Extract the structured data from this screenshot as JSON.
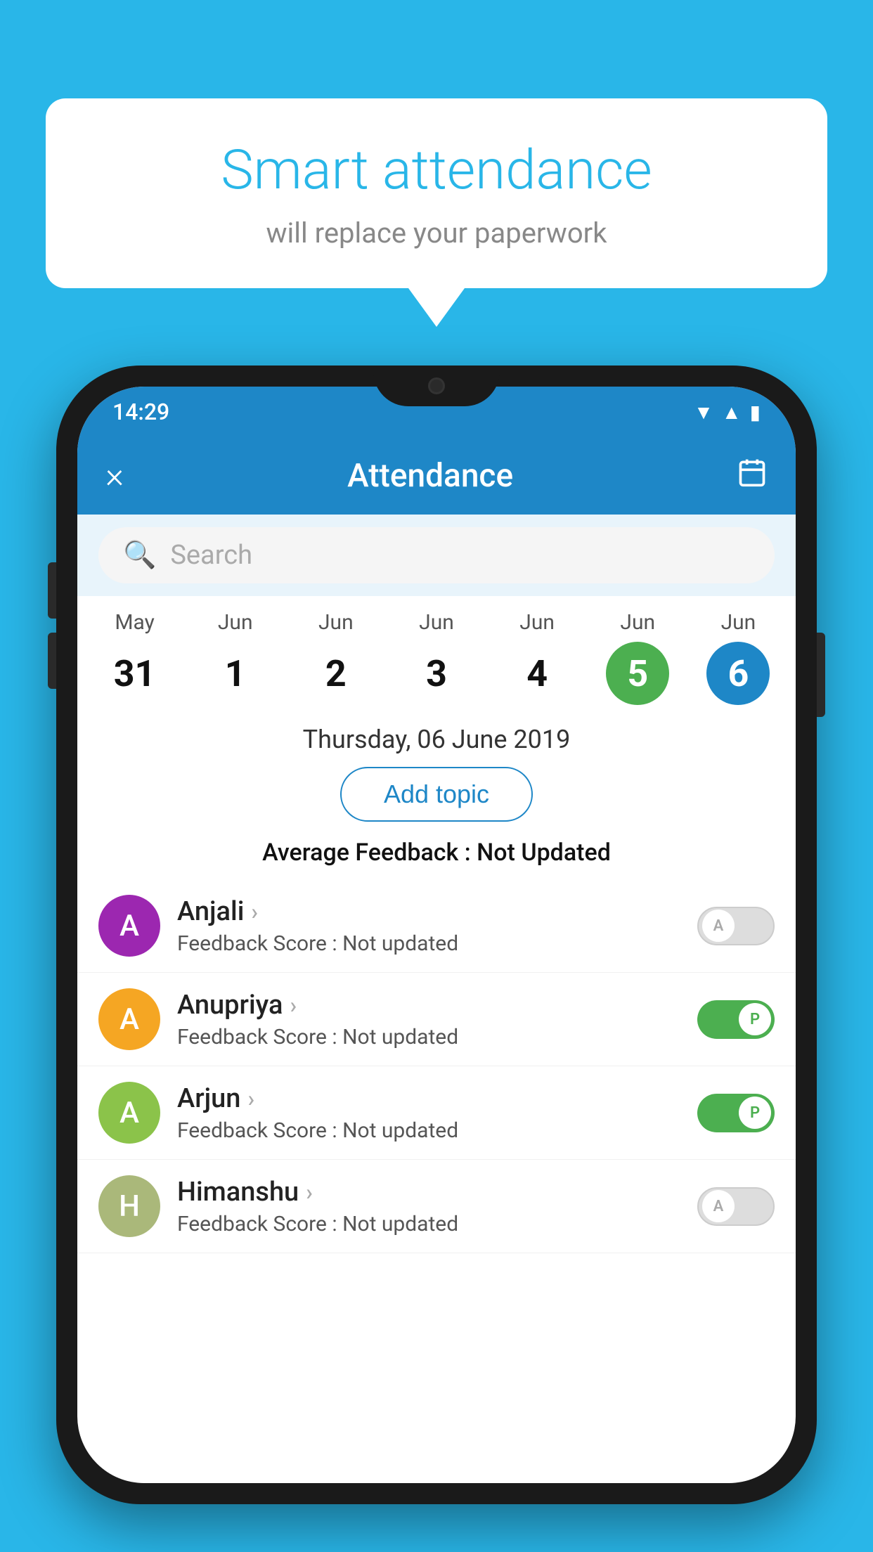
{
  "background_color": "#29b6e8",
  "speech_bubble": {
    "title": "Smart attendance",
    "subtitle": "will replace your paperwork"
  },
  "status_bar": {
    "time": "14:29",
    "icons": [
      "wifi",
      "signal",
      "battery"
    ]
  },
  "app_bar": {
    "close_label": "×",
    "title": "Attendance",
    "calendar_label": "📅"
  },
  "search": {
    "placeholder": "Search"
  },
  "calendar": {
    "days": [
      {
        "month": "May",
        "day": "31",
        "state": "normal"
      },
      {
        "month": "Jun",
        "day": "1",
        "state": "normal"
      },
      {
        "month": "Jun",
        "day": "2",
        "state": "normal"
      },
      {
        "month": "Jun",
        "day": "3",
        "state": "normal"
      },
      {
        "month": "Jun",
        "day": "4",
        "state": "normal"
      },
      {
        "month": "Jun",
        "day": "5",
        "state": "today"
      },
      {
        "month": "Jun",
        "day": "6",
        "state": "selected"
      }
    ],
    "selected_date": "Thursday, 06 June 2019"
  },
  "add_topic_label": "Add topic",
  "avg_feedback": {
    "label": "Average Feedback : ",
    "value": "Not Updated"
  },
  "students": [
    {
      "name": "Anjali",
      "avatar_letter": "A",
      "avatar_color": "#9c27b0",
      "feedback_label": "Feedback Score : ",
      "feedback_value": "Not updated",
      "toggle": "off",
      "toggle_letter": "A"
    },
    {
      "name": "Anupriya",
      "avatar_letter": "A",
      "avatar_color": "#f5a623",
      "feedback_label": "Feedback Score : ",
      "feedback_value": "Not updated",
      "toggle": "on",
      "toggle_letter": "P"
    },
    {
      "name": "Arjun",
      "avatar_letter": "A",
      "avatar_color": "#8bc34a",
      "feedback_label": "Feedback Score : ",
      "feedback_value": "Not updated",
      "toggle": "on",
      "toggle_letter": "P"
    },
    {
      "name": "Himanshu",
      "avatar_letter": "H",
      "avatar_color": "#aab87a",
      "feedback_label": "Feedback Score : ",
      "feedback_value": "Not updated",
      "toggle": "off",
      "toggle_letter": "A"
    }
  ]
}
